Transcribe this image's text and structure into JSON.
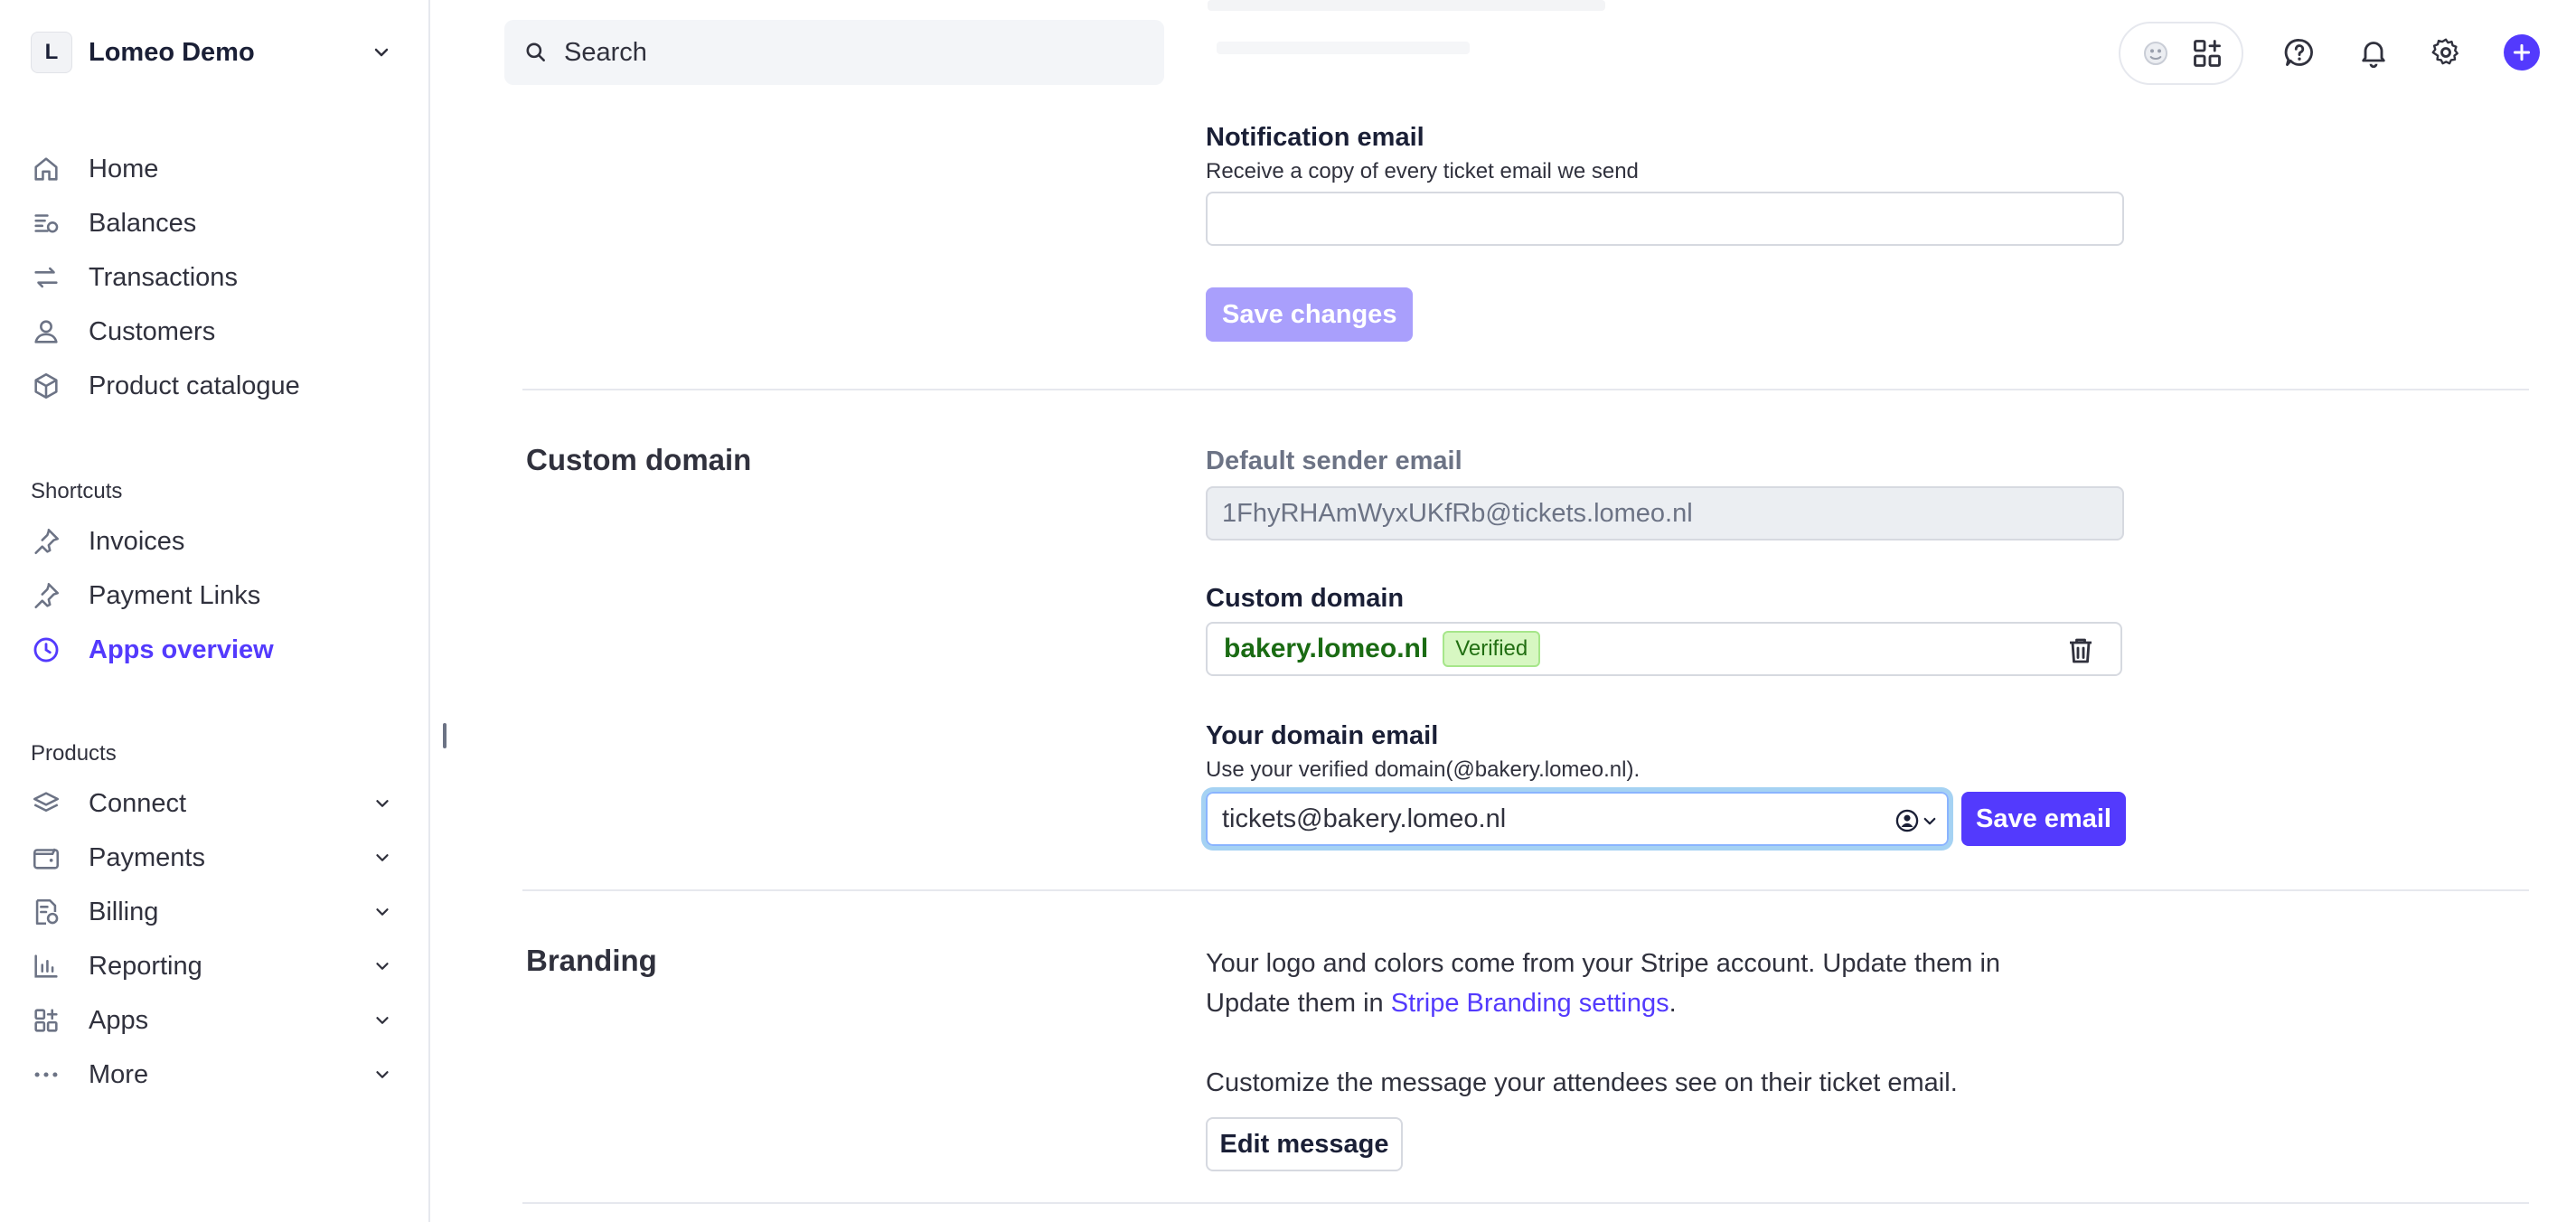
{
  "account": {
    "initial": "L",
    "name": "Lomeo Demo"
  },
  "search": {
    "placeholder": "Search"
  },
  "sidebar": {
    "primary": [
      {
        "label": "Home",
        "icon": "home-icon"
      },
      {
        "label": "Balances",
        "icon": "balances-icon"
      },
      {
        "label": "Transactions",
        "icon": "transactions-icon"
      },
      {
        "label": "Customers",
        "icon": "customers-icon"
      },
      {
        "label": "Product catalogue",
        "icon": "product-catalogue-icon"
      }
    ],
    "shortcuts_label": "Shortcuts",
    "shortcuts": [
      {
        "label": "Invoices",
        "icon": "pin-icon"
      },
      {
        "label": "Payment Links",
        "icon": "pin-icon"
      },
      {
        "label": "Apps overview",
        "icon": "clock-icon",
        "active": true
      }
    ],
    "products_label": "Products",
    "products": [
      {
        "label": "Connect",
        "icon": "connect-icon"
      },
      {
        "label": "Payments",
        "icon": "wallet-icon"
      },
      {
        "label": "Billing",
        "icon": "billing-icon"
      },
      {
        "label": "Reporting",
        "icon": "reporting-icon"
      },
      {
        "label": "Apps",
        "icon": "apps-icon"
      },
      {
        "label": "More",
        "icon": "more-icon"
      }
    ]
  },
  "notification": {
    "label": "Notification email",
    "help": "Receive a copy of every ticket email we send",
    "value": "",
    "save_label": "Save changes"
  },
  "custom_domain_section": {
    "title": "Custom domain",
    "default_sender_label": "Default sender email",
    "default_sender_value": "1FhyRHAmWyxUKfRb@tickets.lomeo.nl",
    "custom_domain_label": "Custom domain",
    "domain_value": "bakery.lomeo.nl",
    "domain_status": "Verified",
    "domain_email_label": "Your domain email",
    "domain_email_help": "Use your verified domain(@bakery.lomeo.nl).",
    "domain_email_value": "tickets@bakery.lomeo.nl",
    "save_email_label": "Save email"
  },
  "branding": {
    "title": "Branding",
    "line1": "Your logo and colors come from your Stripe account. Update them in",
    "line2_prefix": "Update them in ",
    "link_text": "Stripe Branding settings",
    "line2_suffix": ".",
    "customize_text": "Customize the message your attendees see on their ticket email.",
    "edit_label": "Edit message"
  },
  "colors": {
    "accent": "#533afd",
    "verified_bg": "#d7f7c2",
    "verified_text": "#216e12"
  }
}
